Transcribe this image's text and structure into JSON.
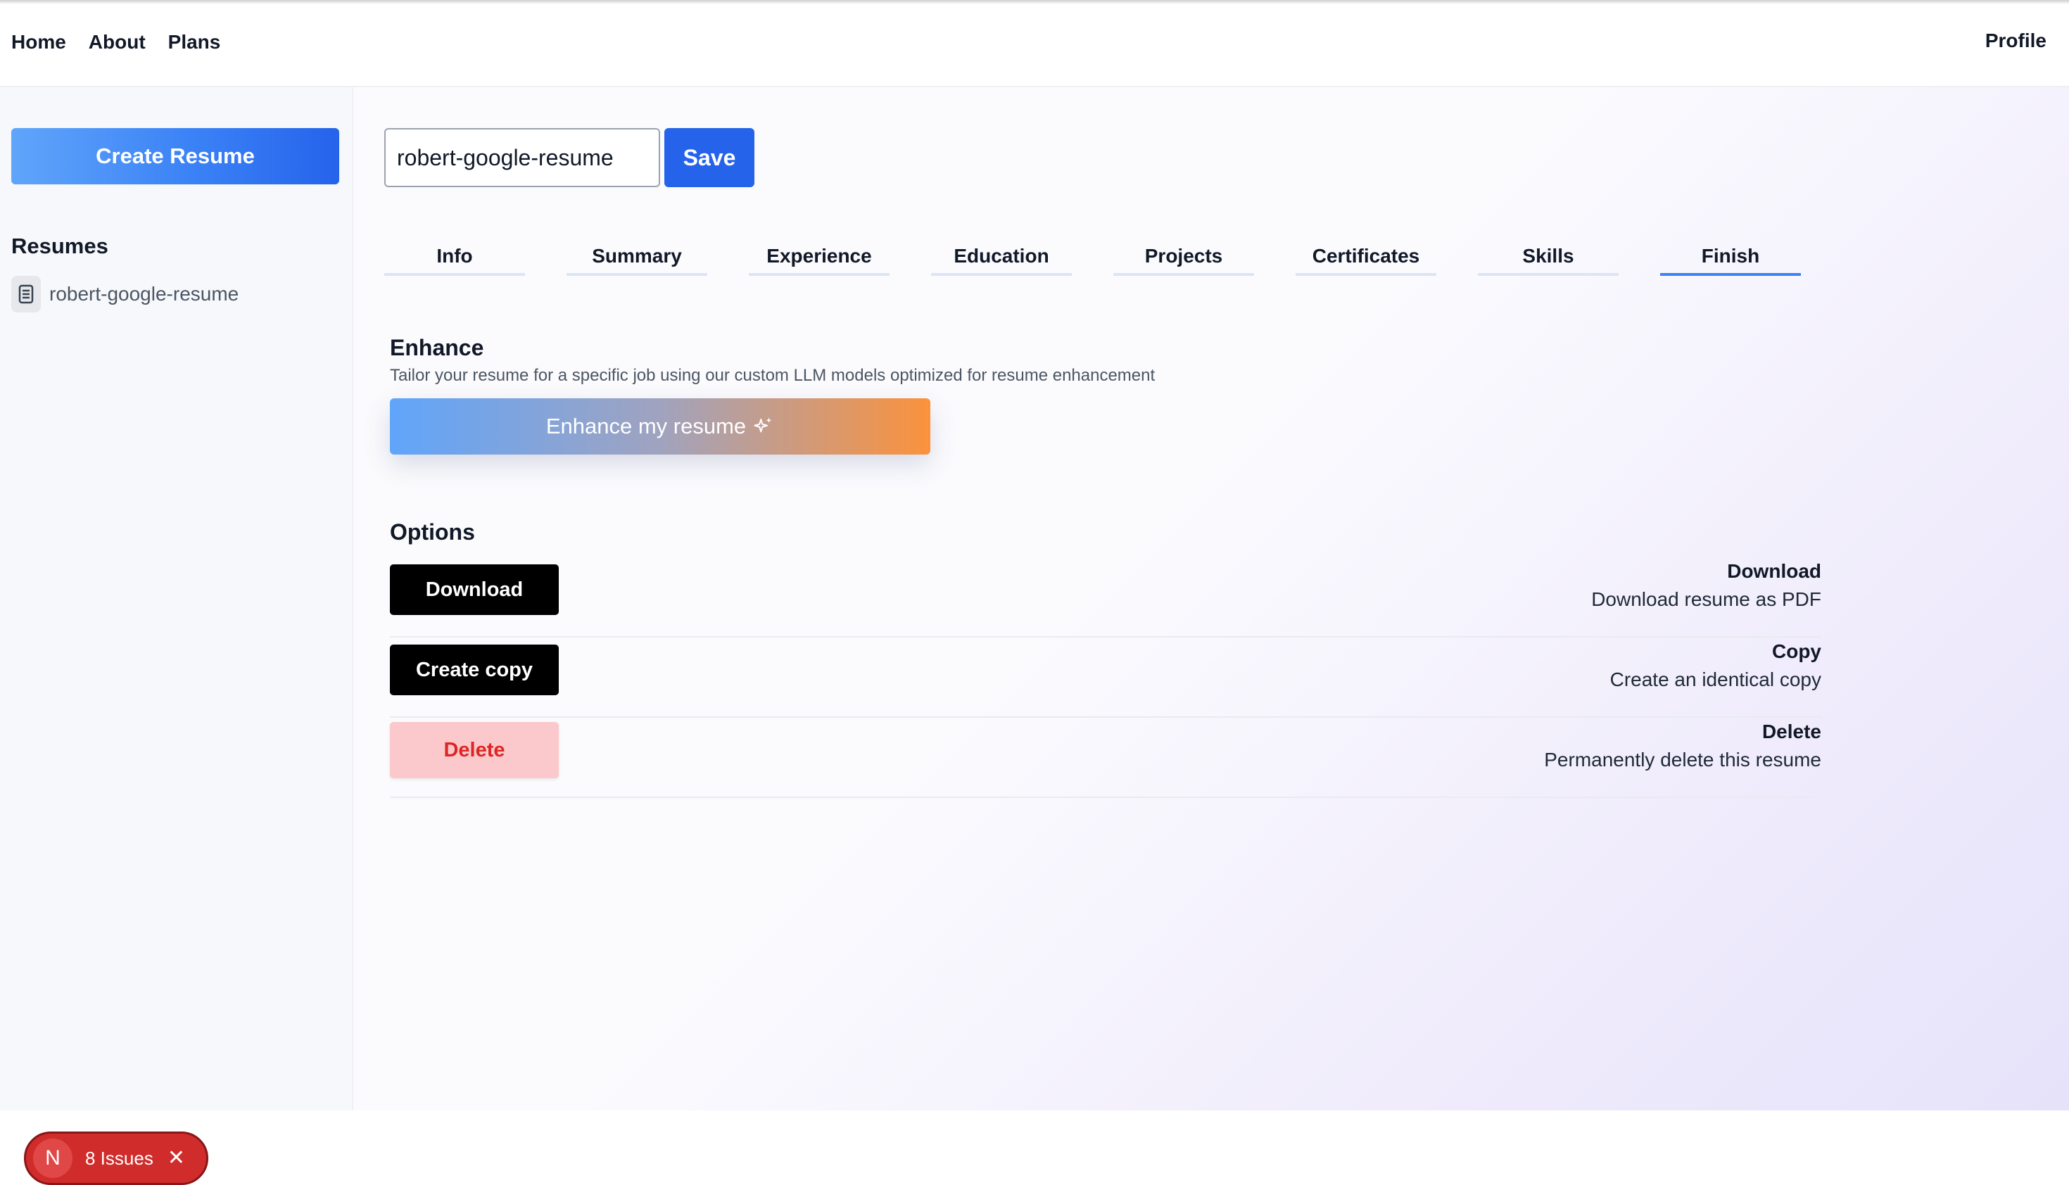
{
  "nav": {
    "items": [
      "Home",
      "About",
      "Plans"
    ],
    "profile": "Profile"
  },
  "sidebar": {
    "create_label": "Create Resume",
    "resumes_title": "Resumes",
    "resume_items": [
      "robert-google-resume"
    ]
  },
  "editor": {
    "name_value": "robert-google-resume",
    "save_label": "Save"
  },
  "tabs": [
    {
      "label": "Info",
      "active": false
    },
    {
      "label": "Summary",
      "active": false
    },
    {
      "label": "Experience",
      "active": false
    },
    {
      "label": "Education",
      "active": false
    },
    {
      "label": "Projects",
      "active": false
    },
    {
      "label": "Certificates",
      "active": false
    },
    {
      "label": "Skills",
      "active": false
    },
    {
      "label": "Finish",
      "active": true
    }
  ],
  "enhance": {
    "title": "Enhance",
    "description": "Tailor your resume for a specific job using our custom LLM models optimized for resume enhancement",
    "button_label": "Enhance my resume",
    "button_icon": "sparkles-icon"
  },
  "options": {
    "title": "Options",
    "rows": [
      {
        "button": "Download",
        "title": "Download",
        "desc": "Download resume as PDF"
      },
      {
        "button": "Create copy",
        "title": "Copy",
        "desc": "Create an identical copy"
      },
      {
        "button": "Delete",
        "title": "Delete",
        "desc": "Permanently delete this resume"
      }
    ]
  },
  "issues_badge": {
    "initial": "N",
    "label": "8 Issues"
  },
  "colors": {
    "primary": "#2563eb",
    "danger_bg": "#fbc9cb",
    "danger_text": "#dc2626",
    "badge": "#d02c2c"
  }
}
